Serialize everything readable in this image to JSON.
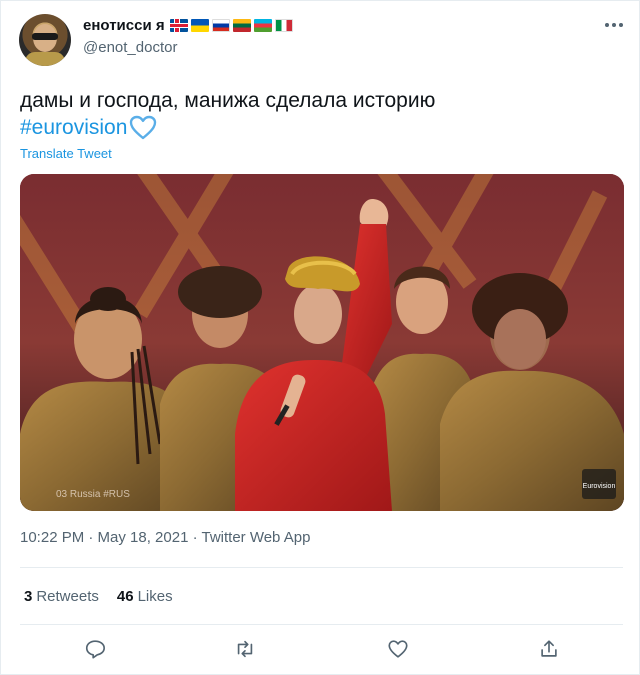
{
  "user": {
    "display_name": "енотисси я",
    "handle": "@enot_doctor",
    "flags": [
      "iceland-flag",
      "ukraine-flag",
      "russia-flag",
      "lithuania-flag",
      "azerbaijan-flag",
      "italy-flag"
    ],
    "avatar": "user-avatar"
  },
  "tweet": {
    "text_line1": "дамы и господа, манижа сделала историю",
    "hashtag": "#eurovision",
    "emoji": "blue-heart-emoji",
    "translate_label": "Translate Tweet",
    "media_caption": "03 Russia #RUS",
    "media_logo": "Eurovision",
    "timestamp": "10:22 PM · May 18, 2021 · Twitter Web App"
  },
  "stats": {
    "retweets_count": "3",
    "retweets_label": "Retweets",
    "likes_count": "46",
    "likes_label": "Likes"
  },
  "actions": [
    "reply-icon",
    "retweet-icon",
    "like-icon",
    "share-icon"
  ],
  "colors": {
    "link": "#1b95e0",
    "secondary_text": "#536471",
    "primary_text": "#0f1419",
    "divider": "#e6ecf0"
  }
}
